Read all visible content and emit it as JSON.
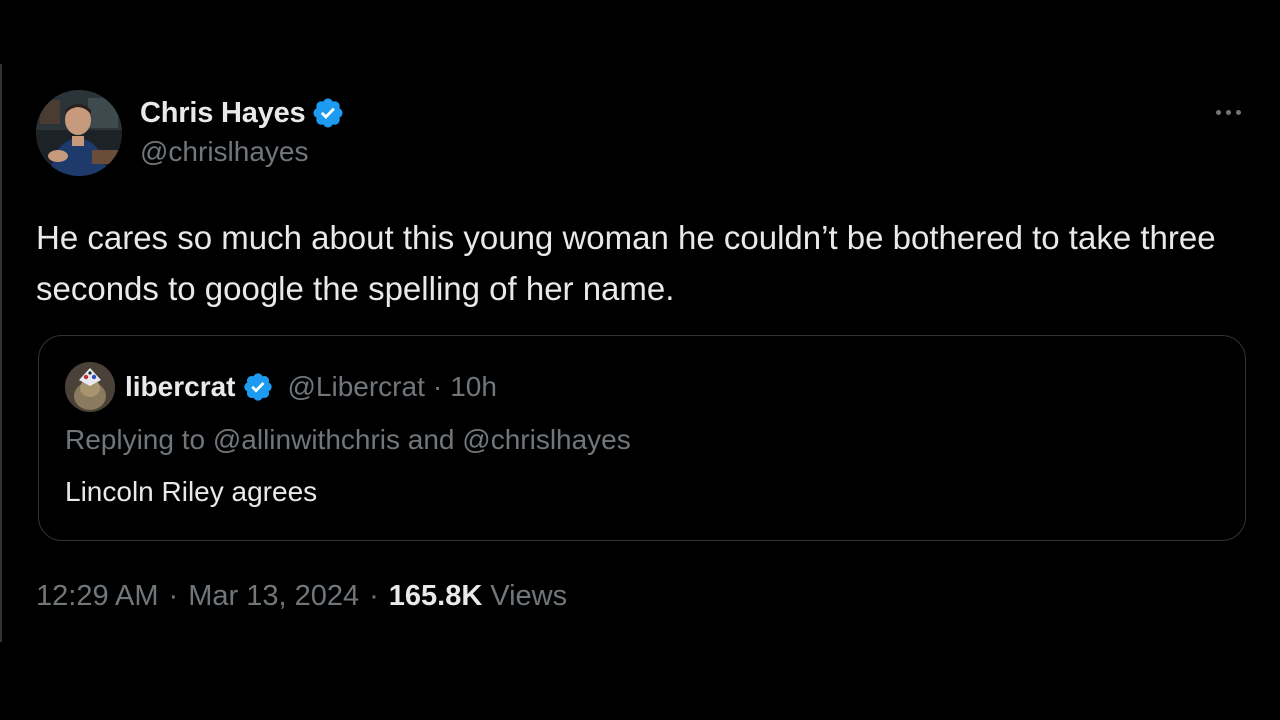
{
  "tweet": {
    "author": {
      "display_name": "Chris Hayes",
      "handle": "@chrislhayes",
      "verified": true,
      "verified_color": "#1d9bf0"
    },
    "more_icon": "more-horizontal-icon",
    "text": "He cares so much about this young woman he couldn’t be bothered to take three seconds to google the spelling of her name.",
    "quoted": {
      "display_name": "libercrat",
      "handle": "@Libercrat",
      "separator": "·",
      "time": "10h",
      "replying_to": "Replying to @allinwithchris and @chrislhayes",
      "text": "Lincoln Riley agrees"
    },
    "meta": {
      "time": "12:29 AM",
      "separator": "·",
      "date": "Mar 13, 2024",
      "views_count": "165.8K",
      "views_label": "Views"
    }
  },
  "colors": {
    "background": "#000000",
    "text_primary": "#e7e9ea",
    "text_secondary": "#71767b",
    "border": "#2f3336",
    "accent": "#1d9bf0"
  }
}
